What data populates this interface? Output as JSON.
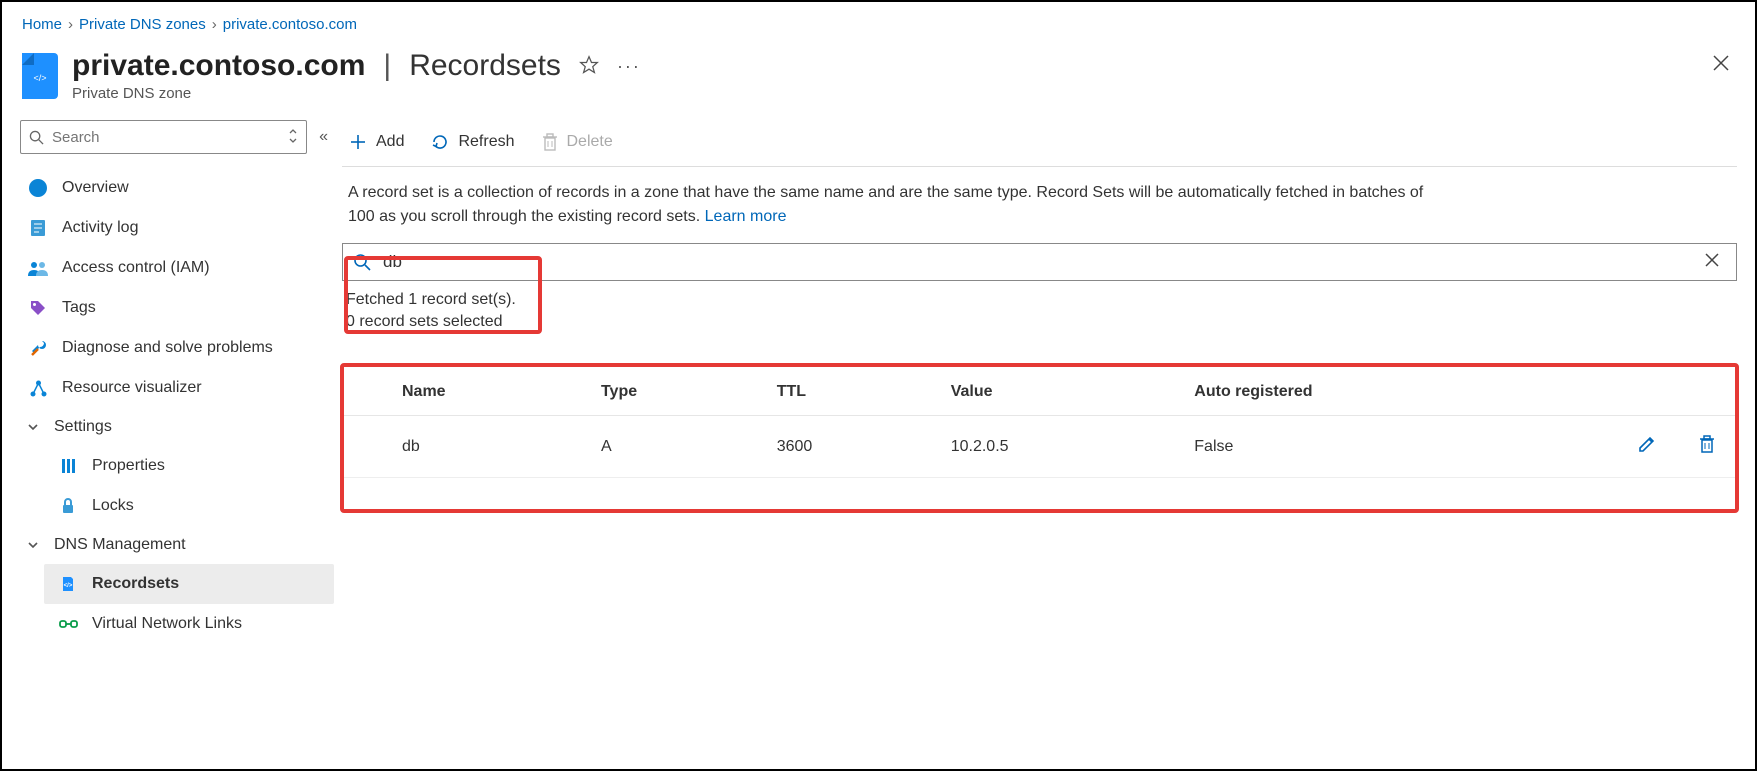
{
  "breadcrumb": {
    "home": "Home",
    "zones": "Private DNS zones",
    "current": "private.contoso.com"
  },
  "header": {
    "resource_name": "private.contoso.com",
    "section": "Recordsets",
    "subtitle": "Private DNS zone"
  },
  "sidebar": {
    "search_placeholder": "Search",
    "items": {
      "overview": "Overview",
      "activity": "Activity log",
      "iam": "Access control (IAM)",
      "tags": "Tags",
      "diagnose": "Diagnose and solve problems",
      "visualizer": "Resource visualizer"
    },
    "settings_label": "Settings",
    "settings": {
      "properties": "Properties",
      "locks": "Locks"
    },
    "dns_label": "DNS Management",
    "dns": {
      "recordsets": "Recordsets",
      "vnl": "Virtual Network Links"
    }
  },
  "toolbar": {
    "add": "Add",
    "refresh": "Refresh",
    "delete": "Delete"
  },
  "description": {
    "text": "A record set is a collection of records in a zone that have the same name and are the same type. Record Sets will be automatically fetched in batches of 100 as you scroll through the existing record sets.",
    "learn_more": "Learn more"
  },
  "filter": {
    "value": "db"
  },
  "status": {
    "fetched": "Fetched 1 record set(s).",
    "selected": "0 record sets selected"
  },
  "table": {
    "headers": {
      "name": "Name",
      "type": "Type",
      "ttl": "TTL",
      "value": "Value",
      "auto": "Auto registered"
    },
    "rows": [
      {
        "name": "db",
        "type": "A",
        "ttl": "3600",
        "value": "10.2.0.5",
        "auto": "False"
      }
    ]
  }
}
